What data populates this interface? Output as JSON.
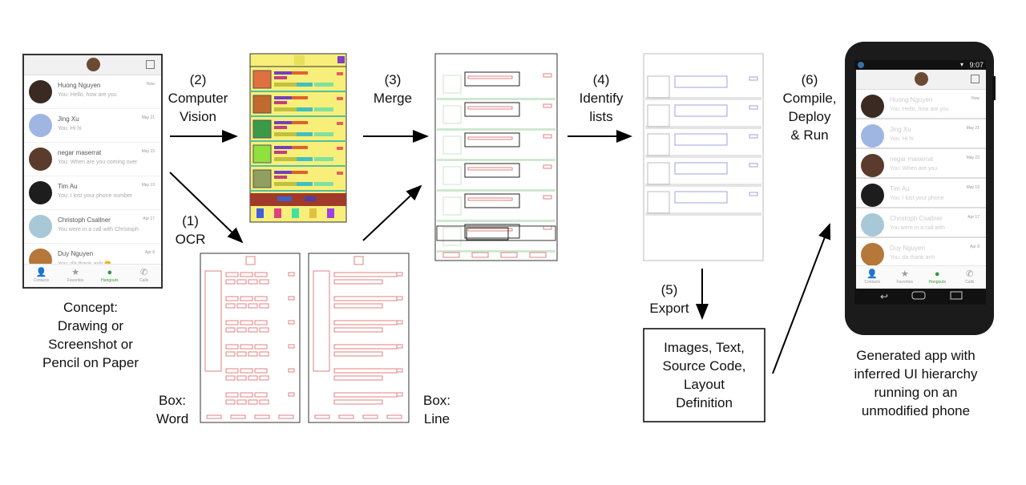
{
  "steps": {
    "cv": "(2)\nComputer\nVision",
    "ocr": "(1)\nOCR",
    "merge": "(3)\nMerge",
    "identify": "(4)\nIdentify\nlists",
    "export": "(5)\nExport",
    "compile": "(6)\nCompile,\nDeploy\n& Run"
  },
  "captions": {
    "concept": "Concept:\nDrawing or\nScreenshot or\nPencil on Paper",
    "box_word": "Box:\nWord",
    "box_line": "Box:\nLine",
    "export_output": "Images, Text,\nSource Code,\nLayout\nDefinition",
    "generated": "Generated app with\ninferred UI hierarchy\nrunning on an\nunmodified phone"
  },
  "app": {
    "contacts": [
      {
        "name": "Huong Nguyen",
        "message": "You: Hello, how are you",
        "date": "Now",
        "color": "#3b2a22"
      },
      {
        "name": "Jing Xu",
        "message": "You: Hi hi",
        "date": "May 21",
        "color": "#9fb6e2"
      },
      {
        "name": "negar maserrat",
        "message": "You: When are you coming over",
        "date": "May 23",
        "color": "#5a3b2c"
      },
      {
        "name": "Tim Au",
        "message": "You: I lost your phone number",
        "date": "May 19",
        "color": "#1d1d1d"
      },
      {
        "name": "Christoph Csallner",
        "message": "You were in a call with Christoph",
        "date": "Apr 17",
        "color": "#a8c8d8"
      },
      {
        "name": "Duy Nguyen",
        "message": "You: da thank anh 😊",
        "date": "Apr 8",
        "color": "#b5773a"
      }
    ],
    "tabs": [
      {
        "label": "Contacts",
        "icon": "person-icon",
        "glyph": "👤"
      },
      {
        "label": "Favorites",
        "icon": "star-icon",
        "glyph": "★"
      },
      {
        "label": "Hangouts",
        "icon": "hangouts-icon",
        "glyph": "●"
      },
      {
        "label": "Calls",
        "icon": "phone-icon",
        "glyph": "✆"
      }
    ],
    "generated_messages": [
      "You: Hello, how are you",
      "You: Hi hi",
      "You: When are you",
      "You: I lost your phone",
      "You were in a call with",
      "You: da thank anh"
    ],
    "status_time": "9:07"
  }
}
